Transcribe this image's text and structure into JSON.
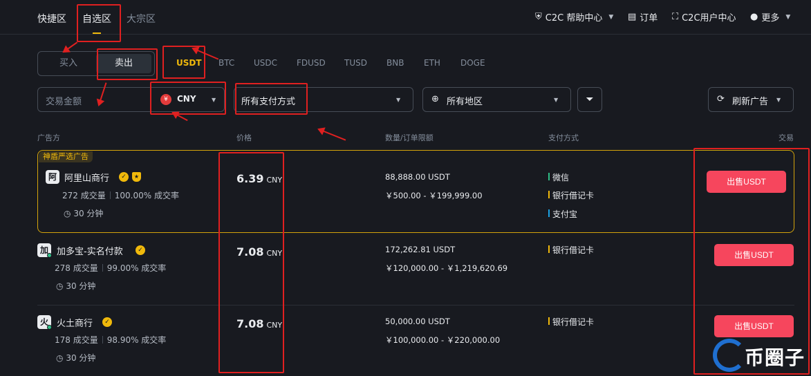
{
  "nav": {
    "tabs": [
      "快捷区",
      "自选区",
      "大宗区"
    ],
    "active_tab": "自选区",
    "right": {
      "help": "C2C 帮助中心",
      "orders": "订单",
      "user_center": "C2C用户中心",
      "more": "更多"
    }
  },
  "trade_type": {
    "buy": "买入",
    "sell": "卖出",
    "active": "卖出"
  },
  "coins": [
    "USDT",
    "BTC",
    "USDC",
    "FDUSD",
    "TUSD",
    "BNB",
    "ETH",
    "DOGE"
  ],
  "active_coin": "USDT",
  "filters": {
    "amount_placeholder": "交易金额",
    "fiat": "CNY",
    "fiat_badge": "¥",
    "payment": "所有支付方式",
    "region": "所有地区",
    "refresh": "刷新广告"
  },
  "table": {
    "headers": {
      "advertiser": "广告方",
      "price": "价格",
      "limits": "数量/订单限额",
      "payment": "支付方式",
      "trade": "交易"
    },
    "promo_tag": "神盾严选广告",
    "rows": [
      {
        "avatar": "阿",
        "name": "阿里山商行",
        "orders": "272 成交量",
        "completion": "100.00% 成交率",
        "time": "30 分钟",
        "price": "6.39",
        "unit": "CNY",
        "quantity": "88,888.00 USDT",
        "limit": "￥500.00 - ￥199,999.00",
        "payments": [
          {
            "name": "微信",
            "color": "#2ebd85"
          },
          {
            "name": "银行借记卡",
            "color": "#f0b90b"
          },
          {
            "name": "支付宝",
            "color": "#1ba1e2"
          }
        ],
        "button": "出售USDT"
      },
      {
        "avatar": "加",
        "name": "加多宝-实名付款",
        "orders": "278 成交量",
        "completion": "99.00% 成交率",
        "time": "30 分钟",
        "price": "7.08",
        "unit": "CNY",
        "quantity": "172,262.81 USDT",
        "limit": "￥120,000.00 - ￥1,219,620.69",
        "payments": [
          {
            "name": "银行借记卡",
            "color": "#f0b90b"
          }
        ],
        "button": "出售USDT"
      },
      {
        "avatar": "火",
        "name": "火土商行",
        "orders": "178 成交量",
        "completion": "98.90% 成交率",
        "time": "30 分钟",
        "price": "7.08",
        "unit": "CNY",
        "quantity": "50,000.00 USDT",
        "limit": "￥100,000.00 - ￥220,000.00",
        "payments": [
          {
            "name": "银行借记卡",
            "color": "#f0b90b"
          }
        ],
        "button": "出售USDT"
      }
    ]
  },
  "watermark": "币圈子"
}
